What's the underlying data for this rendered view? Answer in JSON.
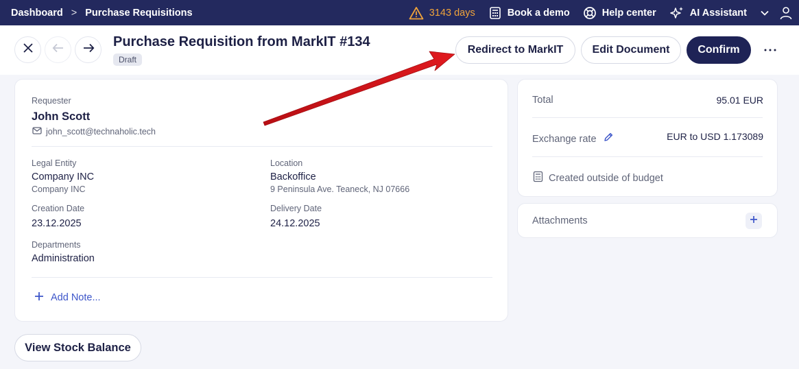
{
  "topbar": {
    "breadcrumb": [
      "Dashboard",
      "Purchase Requisitions"
    ],
    "trial_days": "3143 days",
    "book_demo": "Book a demo",
    "help_center": "Help center",
    "ai_assistant": "AI Assistant"
  },
  "header": {
    "title": "Purchase Requisition from MarkIT #134",
    "status": "Draft",
    "redirect_label": "Redirect to MarkIT",
    "edit_label": "Edit Document",
    "confirm_label": "Confirm"
  },
  "details": {
    "requester_label": "Requester",
    "requester_name": "John Scott",
    "requester_email": "john_scott@technaholic.tech",
    "legal_entity_label": "Legal Entity",
    "legal_entity": "Company INC",
    "legal_entity_sub": "Company INC",
    "location_label": "Location",
    "location": "Backoffice",
    "location_address": "9 Peninsula Ave. Teaneck, NJ 07666",
    "creation_date_label": "Creation Date",
    "creation_date": "23.12.2025",
    "delivery_date_label": "Delivery Date",
    "delivery_date": "24.12.2025",
    "departments_label": "Departments",
    "departments": "Administration",
    "add_note": "Add Note..."
  },
  "summary": {
    "total_label": "Total",
    "total_value": "95.01 EUR",
    "exchange_label": "Exchange rate",
    "exchange_value": "EUR to USD 1.173089",
    "budget_note": "Created outside of budget"
  },
  "attachments": {
    "label": "Attachments"
  },
  "view_stock_label": "View Stock Balance",
  "colors": {
    "navbar": "#23295e",
    "primary_button": "#1e2356",
    "warning": "#f0a33a",
    "link": "#3c55c9",
    "annotation_arrow": "#d9161c"
  }
}
